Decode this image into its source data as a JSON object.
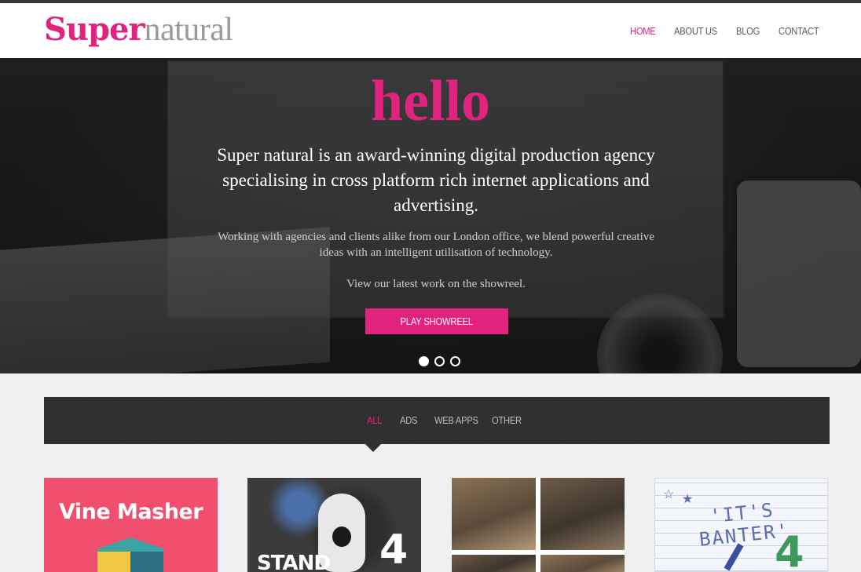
{
  "brand": {
    "logo_part1": "Super",
    "logo_part2": "natural",
    "accent_color": "#e0237e"
  },
  "nav": {
    "home": "HOME",
    "about": "ABOUT US",
    "blog": "BLOG",
    "contact": "CONTACT",
    "active": "HOME"
  },
  "hero": {
    "title": "hello",
    "lead": "Super natural is an award-winning digital production agency specialising in cross platform rich internet applications and advertising.",
    "description": "Working with agencies and clients alike from our London office, we blend powerful creative ideas with an intelligent utilisation of technology.",
    "showreel_note": "View our latest work on the showreel.",
    "play_button": "PLAY SHOWREEL",
    "slides": 3,
    "active_slide": 1
  },
  "filters": {
    "all": "ALL",
    "ads": "ADS",
    "web_apps": "WEB APPS",
    "other": "OTHER",
    "active": "ALL"
  },
  "portfolio": {
    "tile1_title": "Vine Masher",
    "tile2_text": "STAND",
    "tile4_text": "'IT'S BANTER'"
  }
}
